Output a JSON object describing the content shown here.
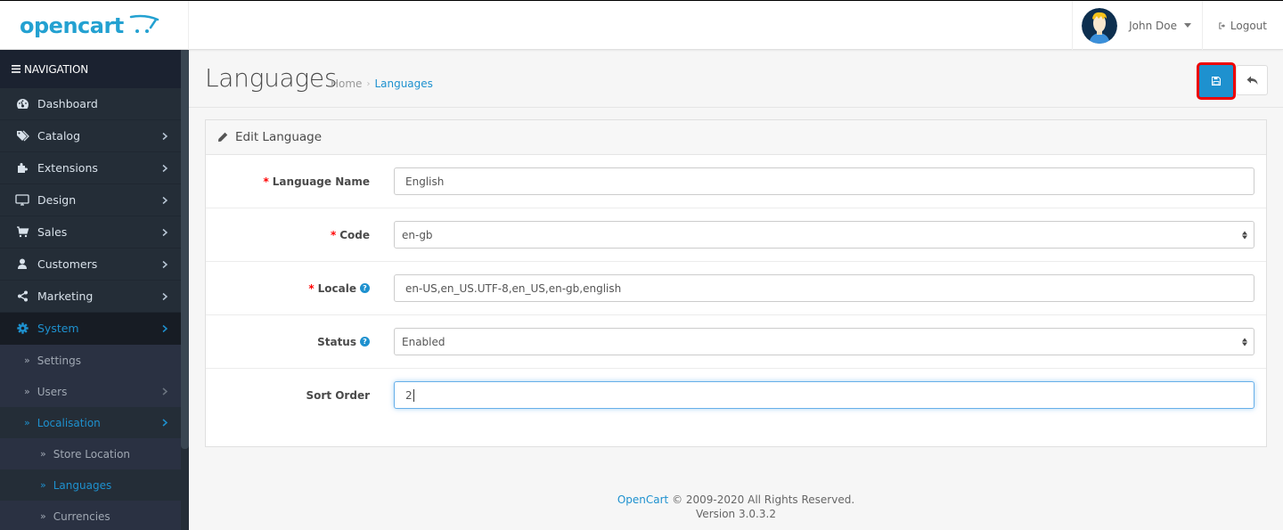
{
  "header": {
    "logo_text": "opencart",
    "user_name": "John Doe",
    "logout_label": "Logout"
  },
  "sidebar": {
    "nav_title": "NAVIGATION",
    "items": [
      {
        "label": "Dashboard",
        "icon": "dashboard-icon",
        "has_children": false
      },
      {
        "label": "Catalog",
        "icon": "tags-icon",
        "has_children": true
      },
      {
        "label": "Extensions",
        "icon": "puzzle-icon",
        "has_children": true
      },
      {
        "label": "Design",
        "icon": "desktop-icon",
        "has_children": true
      },
      {
        "label": "Sales",
        "icon": "cart-icon",
        "has_children": true
      },
      {
        "label": "Customers",
        "icon": "user-icon",
        "has_children": true
      },
      {
        "label": "Marketing",
        "icon": "share-icon",
        "has_children": true
      },
      {
        "label": "System",
        "icon": "gear-icon",
        "has_children": true,
        "active": true
      }
    ],
    "system_children": [
      {
        "label": "Settings",
        "has_children": false
      },
      {
        "label": "Users",
        "has_children": true
      },
      {
        "label": "Localisation",
        "has_children": true,
        "active": true
      }
    ],
    "localisation_children": [
      {
        "label": "Store Location"
      },
      {
        "label": "Languages",
        "active": true
      },
      {
        "label": "Currencies"
      }
    ]
  },
  "page": {
    "title": "Languages",
    "breadcrumb": [
      {
        "label": "Home"
      },
      {
        "label": "Languages",
        "current": true
      }
    ],
    "save_button_label": "Save",
    "back_button_label": "Back"
  },
  "panel": {
    "title": "Edit Language",
    "fields": [
      {
        "label": "Language Name",
        "required": true,
        "help": false,
        "type": "text",
        "value": "English"
      },
      {
        "label": "Code",
        "required": true,
        "help": false,
        "type": "select",
        "value": "en-gb"
      },
      {
        "label": "Locale",
        "required": true,
        "help": true,
        "type": "text",
        "value": "en-US,en_US.UTF-8,en_US,en-gb,english"
      },
      {
        "label": "Status",
        "required": false,
        "help": true,
        "type": "select",
        "value": "Enabled"
      },
      {
        "label": "Sort Order",
        "required": false,
        "help": false,
        "type": "text",
        "value": "2",
        "focused": true
      }
    ]
  },
  "footer": {
    "brand": "OpenCart",
    "copyright": " © 2009-2020 All Rights Reserved.",
    "version": "Version 3.0.3.2"
  },
  "colors": {
    "accent": "#1e91cf",
    "sidebar_bg": "#242d37",
    "required": "#ff0000",
    "highlight_outline": "#ee0000"
  }
}
